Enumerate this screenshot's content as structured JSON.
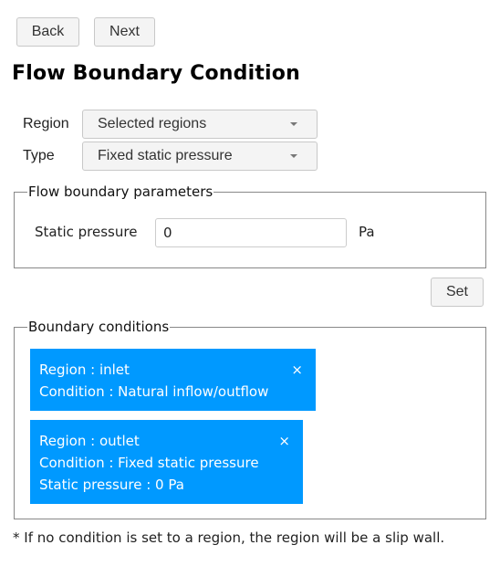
{
  "nav": {
    "back_label": "Back",
    "next_label": "Next"
  },
  "page_title": "Flow Boundary Condition",
  "form": {
    "region_label": "Region",
    "region_value": "Selected regions",
    "type_label": "Type",
    "type_value": "Fixed static pressure"
  },
  "params": {
    "legend": "Flow boundary parameters",
    "static_pressure_label": "Static pressure",
    "static_pressure_value": "0",
    "static_pressure_unit": "Pa"
  },
  "set_label": "Set",
  "boundary_conditions": {
    "legend": "Boundary conditions",
    "close_icon": "×",
    "items": [
      {
        "lines": [
          "Region : inlet",
          "Condition : Natural inflow/outflow"
        ]
      },
      {
        "lines": [
          "Region : outlet",
          "Condition : Fixed static pressure",
          "Static pressure : 0 Pa"
        ]
      }
    ],
    "chip_color": "#0099ff"
  },
  "note": "* If no condition is set to a region, the region will be a slip wall."
}
